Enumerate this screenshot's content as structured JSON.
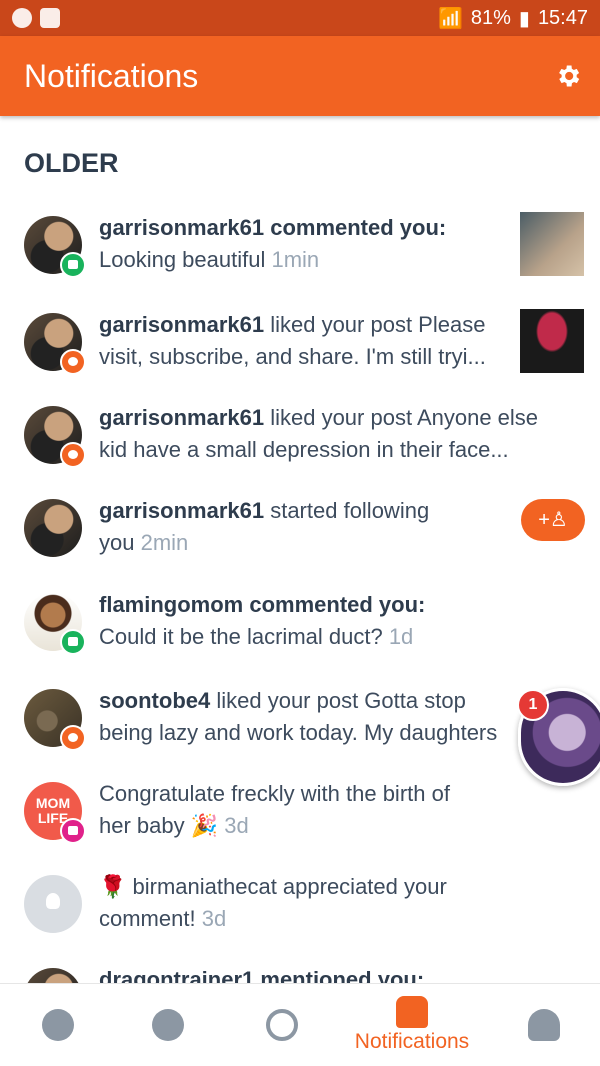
{
  "status_bar": {
    "battery": "81%",
    "time": "15:47"
  },
  "app_bar": {
    "title": "Notifications"
  },
  "section_title": "OLDER",
  "notifications": [
    {
      "user": "garrisonmark61",
      "action": " commented you:",
      "message": "Looking beautiful",
      "time": " 1min"
    },
    {
      "user": "garrisonmark61",
      "action": " liked your post Please visit, subscribe, and share. I'm still tryi...",
      "message": "",
      "time": ""
    },
    {
      "user": "garrisonmark61",
      "action": " liked your post Anyone else kid have a small depression in their face...",
      "message": "",
      "time": ""
    },
    {
      "user": "garrisonmark61",
      "action": " started following you",
      "message": "",
      "time": " 2min"
    },
    {
      "user": "flamingomom",
      "action": " commented you:",
      "message": "Could it be the lacrimal duct?",
      "time": " 1d"
    },
    {
      "user": "soontobe4",
      "action": " liked your post Gotta stop being lazy and work today. My daughters in a cu",
      "message": "",
      "time": ""
    },
    {
      "user": "",
      "action": "Congratulate freckly with the birth of her baby 🎉",
      "message": "",
      "time": " 3d"
    },
    {
      "user": "",
      "action": "🌹 birmaniathecat appreciated your comment!",
      "message": "",
      "time": " 3d"
    },
    {
      "user": "dragontrainer1",
      "action": " mentioned you:",
      "message": "",
      "time": ""
    }
  ],
  "follow_label": "+♙",
  "mom_logo": [
    "MOM",
    "LIFE"
  ],
  "bubble_count": "1",
  "tabbar": {
    "notifications_label": "Notifications"
  }
}
